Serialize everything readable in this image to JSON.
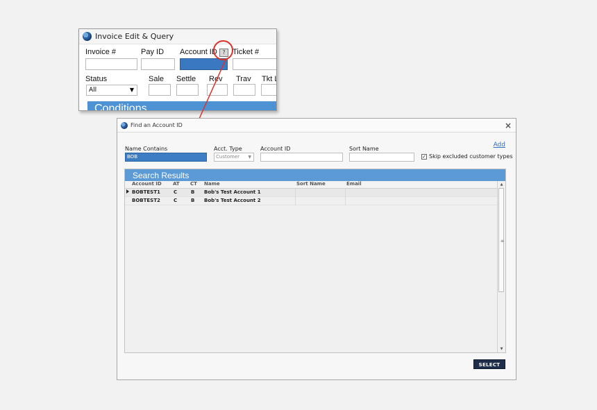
{
  "invoice_window": {
    "title": "Invoice Edit & Query",
    "labels": {
      "invoice_no": "Invoice #",
      "pay_id": "Pay ID",
      "account_id": "Account ID",
      "ticket_no": "Ticket #",
      "status": "Status",
      "sale": "Sale",
      "settle": "Settle",
      "rev": "Rev",
      "trav": "Trav",
      "tkt": "Tkt L"
    },
    "help_button": "?",
    "status_value": "All",
    "conditions_header": "Conditions"
  },
  "find_window": {
    "title": "Find an Account ID",
    "close_glyph": "×",
    "labels": {
      "name_contains": "Name Contains",
      "acct_type": "Acct. Type",
      "account_id": "Account ID",
      "sort_name": "Sort Name"
    },
    "name_contains_value": "BOB",
    "acct_type_value": "Customer",
    "add_link": "Add",
    "skip_excluded_label": "Skip excluded customer types",
    "skip_excluded_checked": true,
    "results_header": "Search Results",
    "columns": [
      "Account ID",
      "AT",
      "CT",
      "Name",
      "Sort Name",
      "Email"
    ],
    "rows": [
      {
        "account_id": "BOBTEST1",
        "at": "C",
        "ct": "B",
        "name": "Bob's Test Account 1",
        "sort_name": "",
        "email": ""
      },
      {
        "account_id": "BOBTEST2",
        "at": "C",
        "ct": "B",
        "name": "Bob's Test Account 2",
        "sort_name": "",
        "email": ""
      }
    ],
    "select_button": "SELECT"
  },
  "colors": {
    "accent_blue": "#5b9ad5",
    "selection_blue": "#3a78c2",
    "callout_red": "#d9322b",
    "select_button": "#1e2d4a"
  }
}
